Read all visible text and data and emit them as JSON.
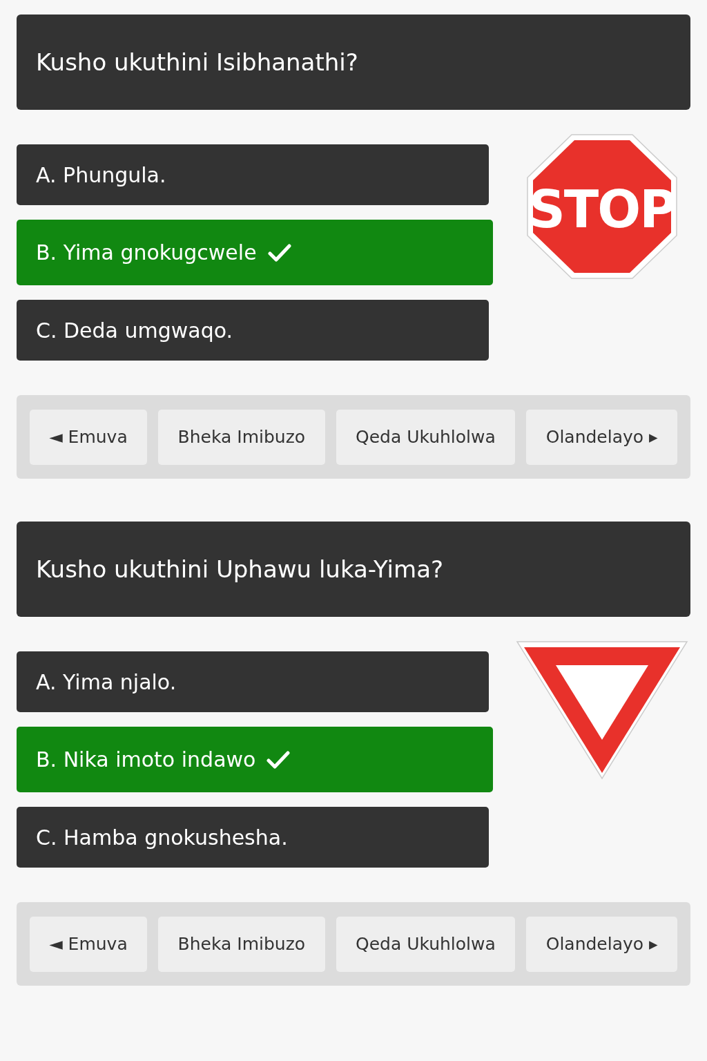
{
  "questions": [
    {
      "title": "Kusho ukuthini Isibhanathi?",
      "sign": {
        "kind": "stop",
        "text": "STOP"
      },
      "options": [
        {
          "label": "A. Phungula.",
          "selected": false
        },
        {
          "label": "B. Yima gnokugcwele",
          "selected": true
        },
        {
          "label": "C. Deda umgwaqo.",
          "selected": false
        }
      ],
      "nav": [
        "◄ Emuva",
        "Bheka Imibuzo",
        "Qeda Ukuhlolwa",
        "Olandelayo ▸"
      ]
    },
    {
      "title": "Kusho ukuthini Uphawu luka-Yima?",
      "sign": {
        "kind": "yield"
      },
      "options": [
        {
          "label": "A. Yima njalo.",
          "selected": false
        },
        {
          "label": "B. Nika imoto indawo",
          "selected": true
        },
        {
          "label": "C. Hamba gnokushesha.",
          "selected": false
        }
      ],
      "nav": [
        "◄ Emuva",
        "Bheka Imibuzo",
        "Qeda Ukuhlolwa",
        "Olandelayo ▸"
      ]
    }
  ]
}
